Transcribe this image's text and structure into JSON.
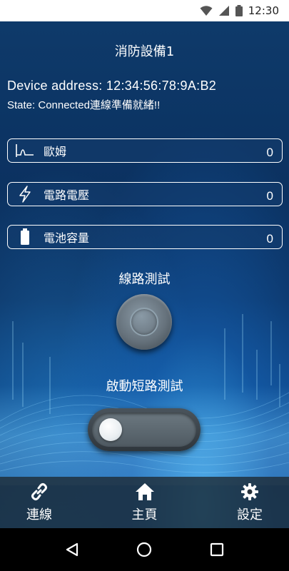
{
  "status_bar": {
    "time": "12:30"
  },
  "screen": {
    "title": "消防設備1",
    "device_address": "Device address: 12:34:56:78:9A:B2",
    "state": "State: Connected連線準備就緒!!"
  },
  "readings": [
    {
      "icon": "waveform-icon",
      "label": "歐姆",
      "value": "0"
    },
    {
      "icon": "lightning-icon",
      "label": "電路電壓",
      "value": "0"
    },
    {
      "icon": "battery-icon",
      "label": "電池容量",
      "value": "0"
    }
  ],
  "line_test": {
    "label": "線路測試"
  },
  "short_test": {
    "label": "啟動短路測試",
    "enabled": false
  },
  "bottom_nav": [
    {
      "icon": "link-icon",
      "label": "連線"
    },
    {
      "icon": "home-icon",
      "label": "主頁"
    },
    {
      "icon": "gear-icon",
      "label": "設定"
    }
  ],
  "colors": {
    "background_top": "#0e3a6a",
    "background_glow": "#3caaf0",
    "text": "#ffffff",
    "nav_bar": "#1e2830"
  }
}
